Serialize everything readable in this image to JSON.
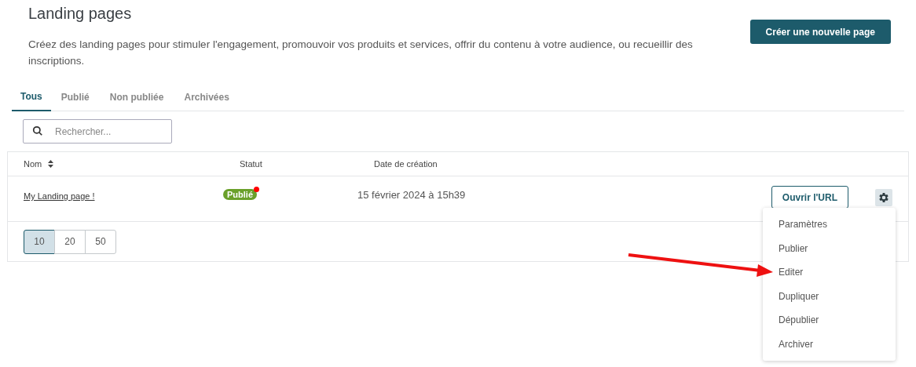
{
  "header": {
    "title": "Landing pages",
    "description": "Créez des landing pages pour stimuler l'engagement, promouvoir vos produits et services, offrir du contenu à votre audience, ou recueillir des inscriptions.",
    "create_button": "Créer une nouvelle page"
  },
  "tabs": [
    {
      "label": "Tous",
      "selected": true
    },
    {
      "label": "Publié",
      "selected": false
    },
    {
      "label": "Non publiée",
      "selected": false
    },
    {
      "label": "Archivées",
      "selected": false
    }
  ],
  "search": {
    "placeholder": "Rechercher..."
  },
  "table": {
    "columns": [
      "Nom",
      "Statut",
      "Date de création"
    ],
    "rows": [
      {
        "name": "My Landing page !",
        "status": "Publié",
        "created": "15 février 2024 à 15h39",
        "open_button": "Ouvrir l'URL"
      }
    ]
  },
  "page_sizes": [
    {
      "label": "10",
      "selected": true
    },
    {
      "label": "20",
      "selected": false
    },
    {
      "label": "50",
      "selected": false
    }
  ],
  "menu": {
    "items": [
      "Paramètres",
      "Publier",
      "Editer",
      "Dupliquer",
      "Dépublier",
      "Archiver"
    ]
  }
}
